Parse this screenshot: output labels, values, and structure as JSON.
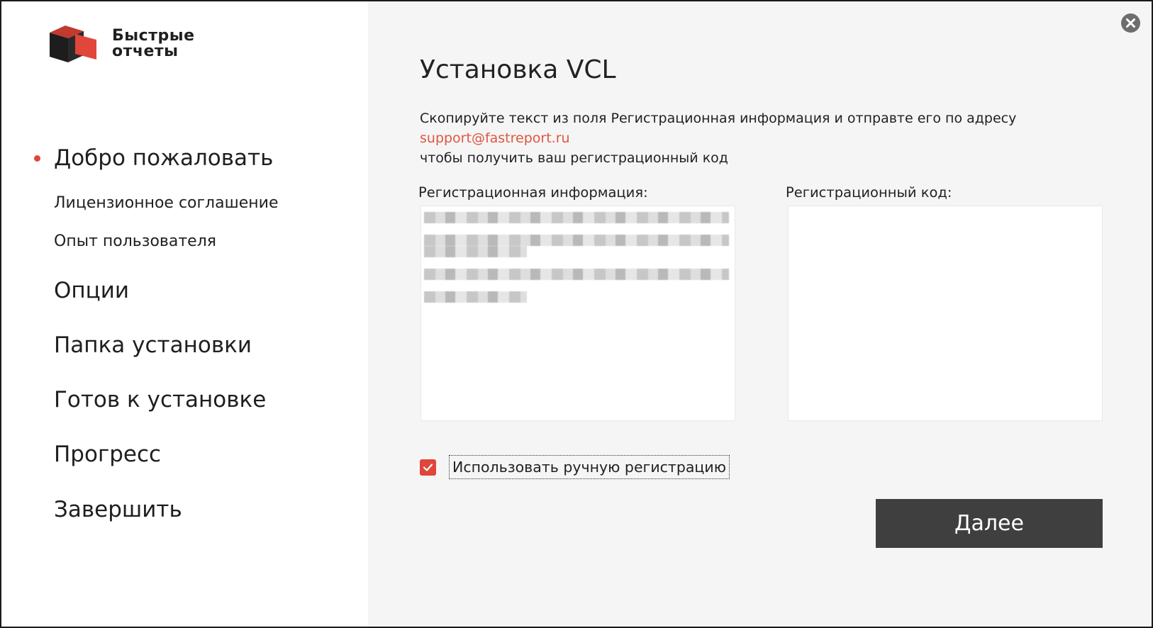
{
  "logo": {
    "line1": "Быстрые",
    "line2": "отчеты"
  },
  "sidebar": {
    "items": [
      {
        "label": "Добро пожаловать",
        "active": true
      },
      {
        "label": "Лицензионное соглашение"
      },
      {
        "label": "Опыт пользователя"
      },
      {
        "label": "Опции"
      },
      {
        "label": "Папка установки"
      },
      {
        "label": "Готов к установке"
      },
      {
        "label": "Прогресс"
      },
      {
        "label": "Завершить"
      }
    ]
  },
  "main": {
    "title": "Установка VCL",
    "instructions": {
      "line1": "Скопируйте текст из поля Регистрационная информация и отправте его по адресу",
      "email": "support@fastreport.ru",
      "line3": "чтобы получить ваш регистрационный код"
    },
    "reg_info_label": "Регистрационная информация:",
    "reg_code_label": "Регистрационный код:",
    "manual_registration_label": "Использовать ручную регистрацию",
    "manual_registration_checked": true,
    "next_label": "Далее"
  },
  "colors": {
    "accent": "#e0463a",
    "button_bg": "#3f3f3f",
    "link": "#e0563f"
  },
  "icons": {
    "close": "close-icon",
    "logo": "cube-logo-icon",
    "check": "checkmark-icon"
  }
}
